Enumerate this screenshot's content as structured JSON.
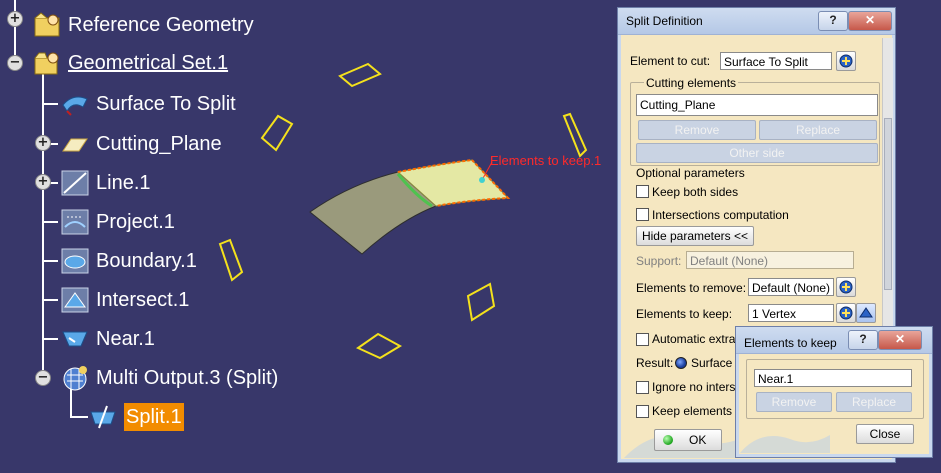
{
  "tree": {
    "nodes": [
      {
        "label": "Reference Geometry",
        "icon": "reference-geometry-icon"
      },
      {
        "label": "Geometrical Set.1",
        "icon": "geometrical-set-icon"
      },
      {
        "label": "Surface To Split",
        "icon": "surface-icon"
      },
      {
        "label": "Cutting_Plane",
        "icon": "plane-icon"
      },
      {
        "label": "Line.1",
        "icon": "line-icon"
      },
      {
        "label": "Project.1",
        "icon": "projection-icon"
      },
      {
        "label": "Boundary.1",
        "icon": "boundary-icon"
      },
      {
        "label": "Intersect.1",
        "icon": "intersection-icon"
      },
      {
        "label": "Near.1",
        "icon": "near-icon"
      },
      {
        "label": "Multi Output.3 (Split)",
        "icon": "multi-output-icon"
      },
      {
        "label": "Split.1",
        "icon": "split-icon"
      }
    ]
  },
  "viewport": {
    "annotation": "Elements to keep.1",
    "colors": {
      "background": "#38376a",
      "plane_outline": "#f4e11c",
      "surface_kept": "#e4e8a4",
      "surface_removed": "#9a9a7c",
      "cut_edge": "#ff6a00",
      "annotation": "#ff2a2a"
    }
  },
  "split_dialog": {
    "title": "Split Definition",
    "help_btn": "?",
    "close_btn": "✕",
    "element_to_cut_label": "Element to cut:",
    "element_to_cut_value": "Surface To Split",
    "cutting_elements_label": "Cutting elements",
    "cutting_elements_list": [
      "Cutting_Plane"
    ],
    "remove_btn": "Remove",
    "replace_btn": "Replace",
    "other_side_btn": "Other side",
    "optional_parameters_label": "Optional parameters",
    "keep_both_sides": "Keep both sides",
    "intersections_computation": "Intersections computation",
    "hide_parameters_btn": "Hide parameters <<",
    "support_label": "Support:",
    "support_value": "Default (None)",
    "elements_to_remove_label": "Elements to remove:",
    "elements_to_remove_value": "Default (None)",
    "elements_to_keep_label": "Elements to keep:",
    "elements_to_keep_value": "1 Vertex",
    "automatic_extrap": "Automatic extrap",
    "result_label": "Result:",
    "result_value": "Surface",
    "ignore_no_interse": "Ignore no interse",
    "keep_elements_in": "Keep elements in",
    "ok_btn": "OK"
  },
  "keep_dialog": {
    "title": "Elements to keep",
    "help_btn": "?",
    "close_btn": "✕",
    "list": [
      "Near.1"
    ],
    "remove_btn": "Remove",
    "replace_btn": "Replace",
    "close_label": "Close"
  }
}
